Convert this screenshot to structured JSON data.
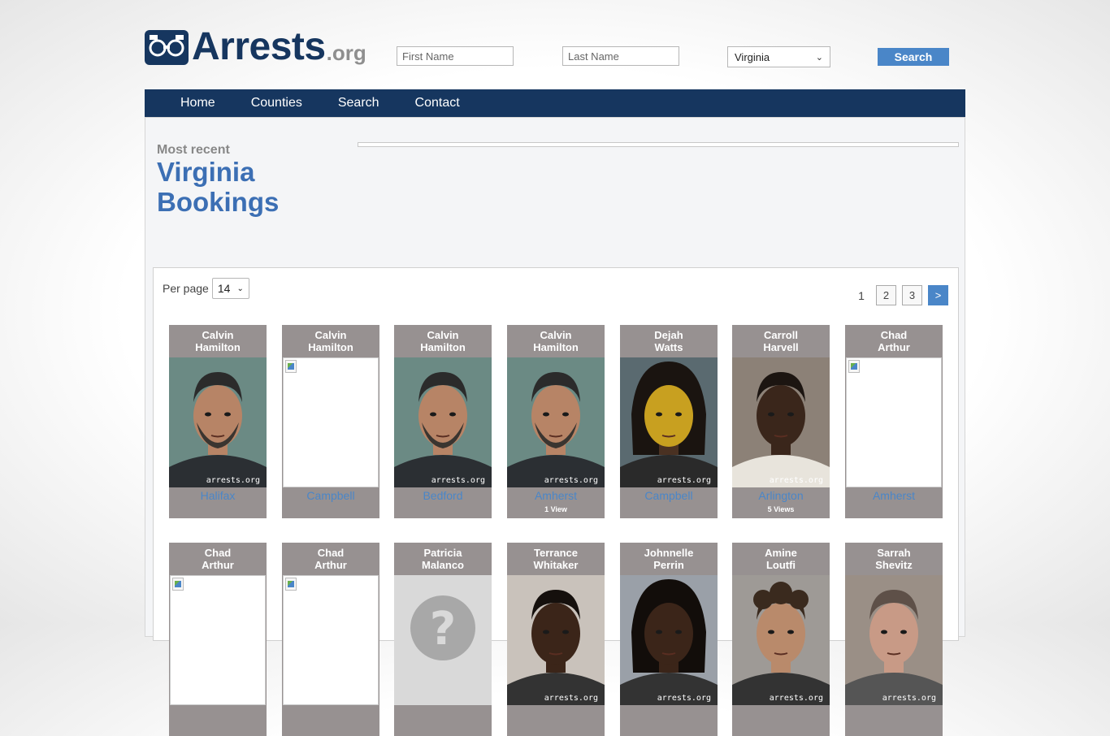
{
  "header": {
    "logo_text": "Arrests",
    "logo_suffix": ".org",
    "first_name_placeholder": "First Name",
    "last_name_placeholder": "Last Name",
    "state_selected": "Virginia",
    "search_label": "Search"
  },
  "nav": {
    "items": [
      "Home",
      "Counties",
      "Search",
      "Contact"
    ]
  },
  "main": {
    "kicker": "Most recent",
    "title_line1": "Virginia",
    "title_line2": "Bookings",
    "per_page_label": "Per page",
    "per_page_value": "14",
    "pager": {
      "current": "1",
      "pages": [
        "2",
        "3"
      ],
      "next": ">"
    }
  },
  "bookings": [
    {
      "first": "Calvin",
      "last": "Hamilton",
      "county": "Halifax",
      "views": "",
      "photo": "mugshot-man-beard"
    },
    {
      "first": "Calvin",
      "last": "Hamilton",
      "county": "Campbell",
      "views": "",
      "photo": "broken"
    },
    {
      "first": "Calvin",
      "last": "Hamilton",
      "county": "Bedford",
      "views": "",
      "photo": "mugshot-man-beard"
    },
    {
      "first": "Calvin",
      "last": "Hamilton",
      "county": "Amherst",
      "views": "1 View",
      "photo": "mugshot-man-beard"
    },
    {
      "first": "Dejah",
      "last": "Watts",
      "county": "Campbell",
      "views": "",
      "photo": "mugshot-woman-locs"
    },
    {
      "first": "Carroll",
      "last": "Harvell",
      "county": "Arlington",
      "views": "5 Views",
      "photo": "mugshot-man-dark"
    },
    {
      "first": "Chad",
      "last": "Arthur",
      "county": "Amherst",
      "views": "",
      "photo": "broken"
    },
    {
      "first": "Chad",
      "last": "Arthur",
      "county": "",
      "views": "",
      "photo": "broken"
    },
    {
      "first": "Chad",
      "last": "Arthur",
      "county": "",
      "views": "",
      "photo": "broken"
    },
    {
      "first": "Patricia",
      "last": "Malanco",
      "county": "",
      "views": "",
      "photo": "placeholder-question"
    },
    {
      "first": "Terrance",
      "last": "Whitaker",
      "county": "",
      "views": "",
      "photo": "mugshot-man-short-hair"
    },
    {
      "first": "Johnnelle",
      "last": "Perrin",
      "county": "",
      "views": "",
      "photo": "mugshot-man-locs"
    },
    {
      "first": "Amine",
      "last": "Loutfi",
      "county": "",
      "views": "",
      "photo": "mugshot-man-curly"
    },
    {
      "first": "Sarrah",
      "last": "Shevitz",
      "county": "",
      "views": "",
      "photo": "mugshot-woman-light"
    }
  ],
  "watermark": "arrests.org"
}
